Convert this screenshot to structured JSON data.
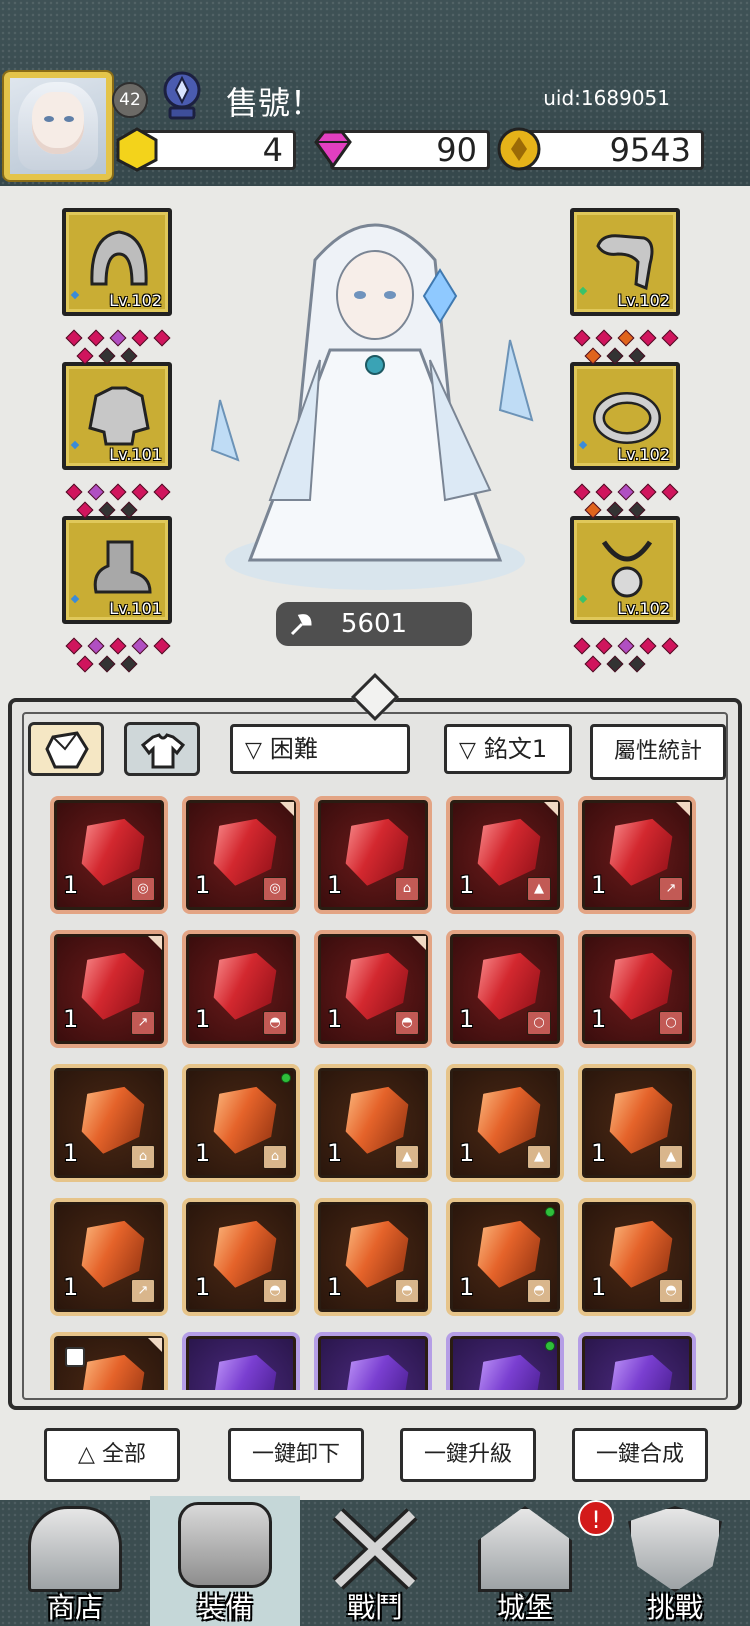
{
  "header": {
    "player_level": "42",
    "player_title": "售號！",
    "uid": "uid:1689051",
    "currencies": [
      {
        "name": "yellow-gem",
        "value": "4"
      },
      {
        "name": "pink-diamond",
        "value": "90"
      },
      {
        "name": "gold-coin",
        "value": "9543"
      }
    ]
  },
  "equipment": {
    "left": [
      {
        "slot": "helmet",
        "level": "Lv.102"
      },
      {
        "slot": "armor",
        "level": "Lv.101"
      },
      {
        "slot": "boots",
        "level": "Lv.101"
      }
    ],
    "right": [
      {
        "slot": "weapon",
        "level": "Lv.102"
      },
      {
        "slot": "ring",
        "level": "Lv.102"
      },
      {
        "slot": "necklace",
        "level": "Lv.102"
      }
    ],
    "power": "5601"
  },
  "inventory": {
    "filters": {
      "difficulty": "困難",
      "rune": "銘文1",
      "stats_button": "屬性統計"
    },
    "rows": [
      {
        "rarity": "red",
        "items": [
          {
            "qty": "1",
            "tag": "◎"
          },
          {
            "qty": "1",
            "tag": "◎"
          },
          {
            "qty": "1",
            "tag": "⌂"
          },
          {
            "qty": "1",
            "tag": "▲"
          },
          {
            "qty": "1",
            "tag": "↗"
          }
        ]
      },
      {
        "rarity": "red",
        "items": [
          {
            "qty": "1",
            "tag": "↗"
          },
          {
            "qty": "1",
            "tag": "◓"
          },
          {
            "qty": "1",
            "tag": "◓"
          },
          {
            "qty": "1",
            "tag": "○"
          },
          {
            "qty": "1",
            "tag": "○"
          }
        ]
      },
      {
        "rarity": "orange",
        "items": [
          {
            "qty": "1",
            "tag": "⌂"
          },
          {
            "qty": "1",
            "tag": "⌂"
          },
          {
            "qty": "1",
            "tag": "▲"
          },
          {
            "qty": "1",
            "tag": "▲"
          },
          {
            "qty": "1",
            "tag": "▲"
          }
        ]
      },
      {
        "rarity": "orange",
        "items": [
          {
            "qty": "1",
            "tag": "↗"
          },
          {
            "qty": "1",
            "tag": "◓"
          },
          {
            "qty": "1",
            "tag": "◓"
          },
          {
            "qty": "1",
            "tag": "◓"
          },
          {
            "qty": "1",
            "tag": "◓"
          }
        ]
      }
    ]
  },
  "actions": {
    "all": "全部",
    "unequip_all": "一鍵卸下",
    "upgrade_all": "一鍵升級",
    "merge_all": "一鍵合成"
  },
  "nav": {
    "shop": "商店",
    "equipment": "裝備",
    "battle": "戰鬥",
    "castle": "城堡",
    "challenge": "挑戰",
    "alert": "!"
  }
}
